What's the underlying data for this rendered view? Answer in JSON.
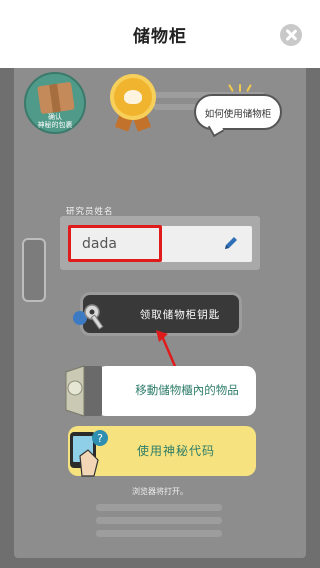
{
  "header": {
    "title": "储物柜",
    "close_icon": "close-icon"
  },
  "top_badges": {
    "box_label_line1": "确认",
    "box_label_line2": "神秘的包裹",
    "medal_icon": "medal-icon",
    "help_bubble_label": "如何使用储物柜"
  },
  "name_panel": {
    "label": "研究员姓名",
    "value": "dada",
    "edit_icon": "pencil-icon"
  },
  "actions": {
    "get_key_label": "领取储物柜钥匙",
    "move_items_label": "移動儲物櫃內的物品",
    "secret_code_label": "使用神秘代码"
  },
  "footer_note": "浏览器将打开。",
  "colors": {
    "header_bg": "#ffffff",
    "locker": "#8d8d8d",
    "highlight": "#e01b1b",
    "accent_green": "#2e7d68",
    "code_button": "#f6e27e"
  }
}
